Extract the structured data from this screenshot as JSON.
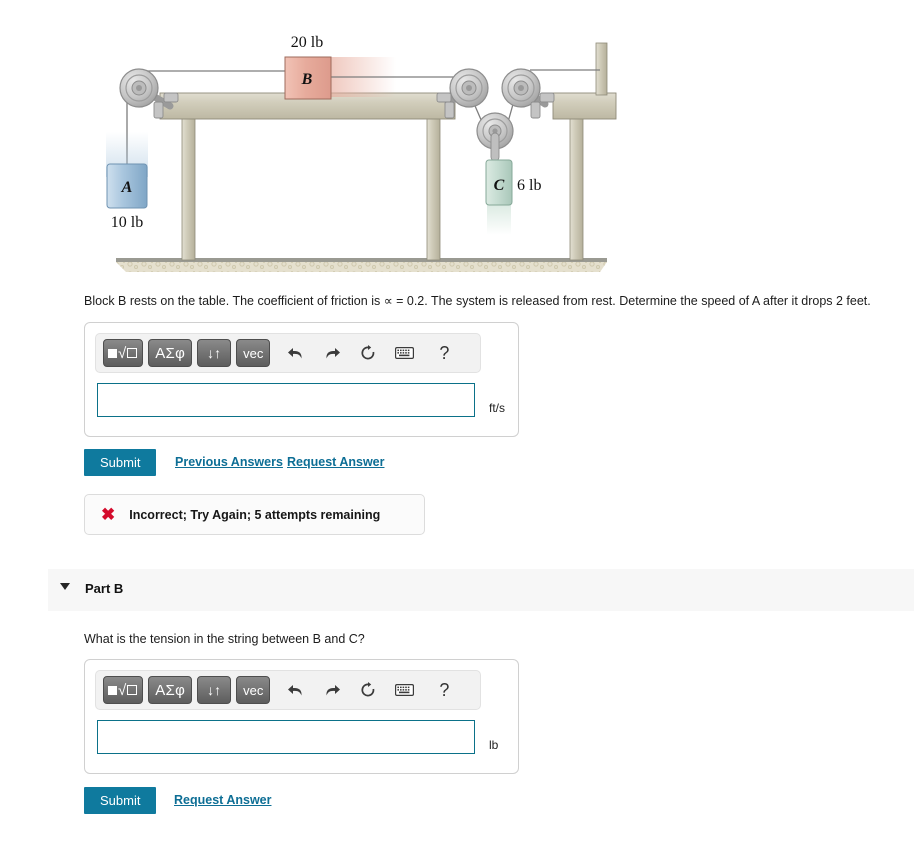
{
  "figure": {
    "title_labels": {
      "block_b_weight": "20 lb",
      "block_b_label": "B",
      "block_a_label": "A",
      "block_a_weight": "10 lb",
      "block_c_label": "C",
      "block_c_weight": "6 lb"
    },
    "colors": {
      "block_a": "#9fc0d9",
      "block_b": "#eab0a2",
      "block_c": "#c3d8ce",
      "wood": "#cdc9b5",
      "pulley": "#c9c9c9",
      "ground": "#ded8c4"
    }
  },
  "part_a": {
    "prompt": "Block B rests on the table. The coefficient of friction is ∝ = 0.2. The system is released from rest.  Determine the speed of A after it drops 2 feet.",
    "toolbar": {
      "template_label": "√",
      "greek_label": "ΑΣφ",
      "arrows_label": "↓↑",
      "vec_label": "vec",
      "undo_icon": "↩",
      "redo_icon": "↪",
      "reset_icon": "↻",
      "keyboard_icon": "⌨",
      "help_icon": "?"
    },
    "input_value": "",
    "input_placeholder": "",
    "unit": "ft/s",
    "submit_label": "Submit",
    "previous_answers_label": "Previous Answers",
    "request_answer_label": "Request Answer",
    "feedback": {
      "icon": "✖",
      "text": "Incorrect; Try Again; 5 attempts remaining"
    }
  },
  "part_b": {
    "header_title": "Part B",
    "question": "What is the tension in the string between B and C?",
    "toolbar": {
      "template_label": "√",
      "greek_label": "ΑΣφ",
      "arrows_label": "↓↑",
      "vec_label": "vec",
      "undo_icon": "↩",
      "redo_icon": "↪",
      "reset_icon": "↻",
      "keyboard_icon": "⌨",
      "help_icon": "?"
    },
    "input_value": "",
    "input_placeholder": "",
    "unit": "lb",
    "submit_label": "Submit",
    "request_answer_label": "Request Answer"
  },
  "theme": {
    "accent": "#0f7a9e",
    "link": "#0d6e95",
    "error": "#d40b2c",
    "input_border": "#0b7189"
  }
}
